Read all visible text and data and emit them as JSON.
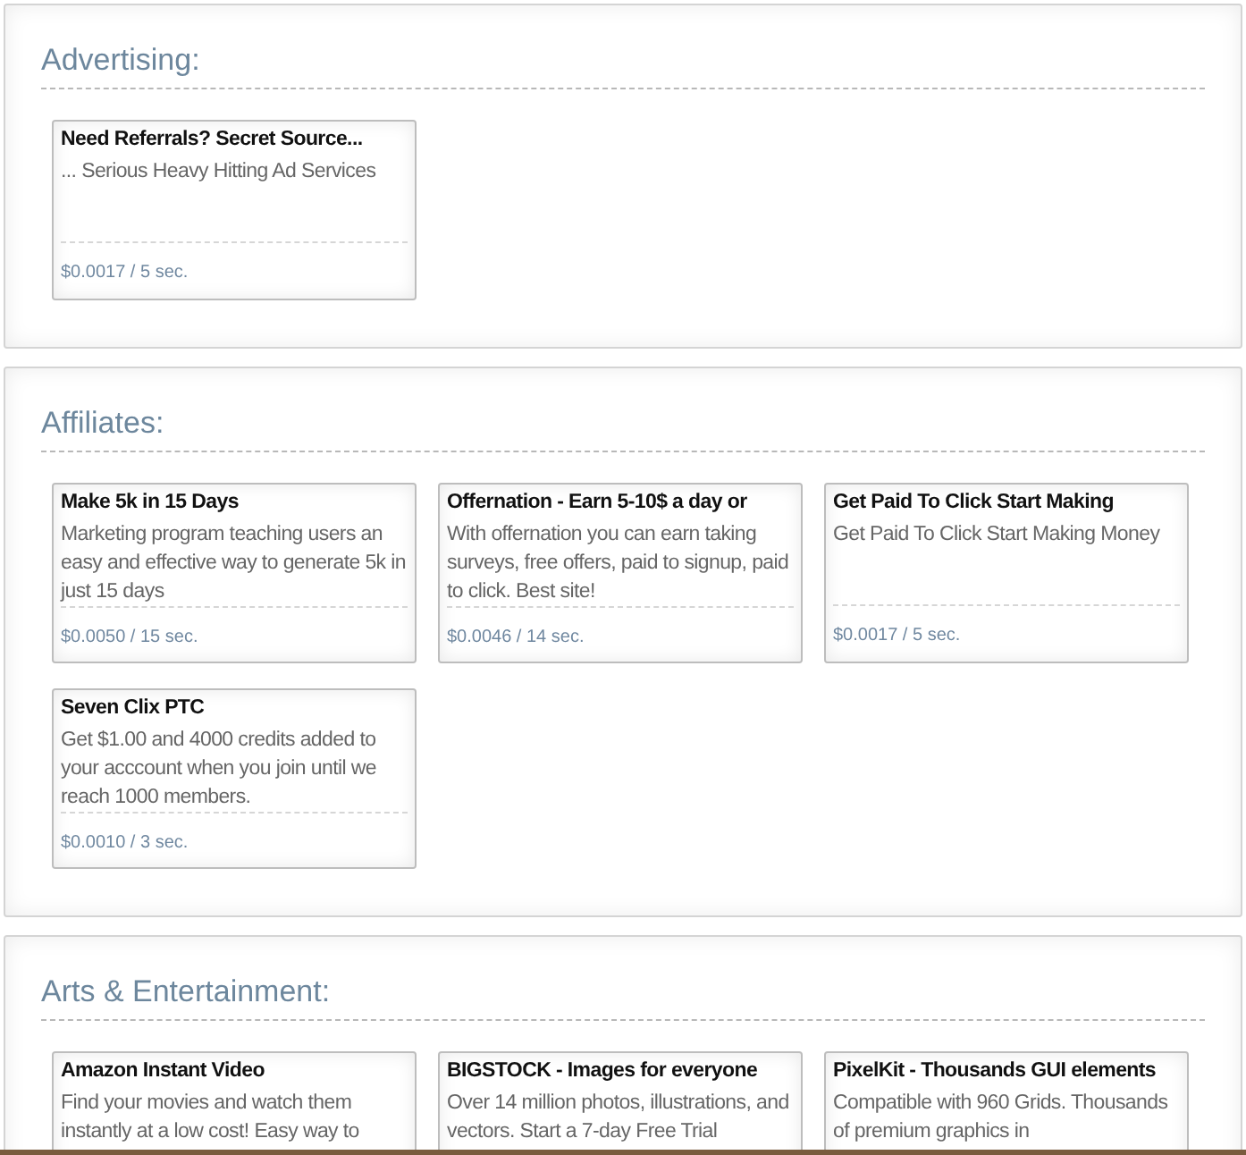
{
  "sections": [
    {
      "title": "Advertising:",
      "ads": [
        {
          "title": "Need Referrals? Secret Source...",
          "description": "... Serious Heavy Hitting Ad Services",
          "price": "$0.0017 / 5 sec."
        }
      ]
    },
    {
      "title": "Affiliates:",
      "ads": [
        {
          "title": "Make 5k in 15 Days",
          "description": "Marketing program teaching users an easy and effective way to generate 5k in just 15 days",
          "price": "$0.0050 / 15 sec."
        },
        {
          "title": "Offernation - Earn 5-10$ a day or",
          "description": "With offernation you can earn taking surveys, free offers, paid to signup, paid to click. Best site!",
          "price": "$0.0046 / 14 sec."
        },
        {
          "title": "Get Paid To Click Start Making",
          "description": "Get Paid To Click Start Making Money",
          "price": "$0.0017 / 5 sec."
        },
        {
          "title": "Seven Clix PTC",
          "description": "Get $1.00 and 4000 credits added to your acccount when you join until we reach 1000 members.",
          "price": "$0.0010 / 3 sec."
        }
      ]
    },
    {
      "title": "Arts & Entertainment:",
      "ads": [
        {
          "title": "Amazon Instant Video",
          "description": "Find your movies and watch them instantly at a low cost! Easy way to"
        },
        {
          "title": "BIGSTOCK - Images for everyone",
          "description": "Over 14 million photos, illustrations, and vectors. Start a 7-day Free Trial"
        },
        {
          "title": "PixelKit - Thousands GUI elements",
          "description": "Compatible with 960 Grids. Thousands of premium graphics in"
        }
      ]
    }
  ]
}
